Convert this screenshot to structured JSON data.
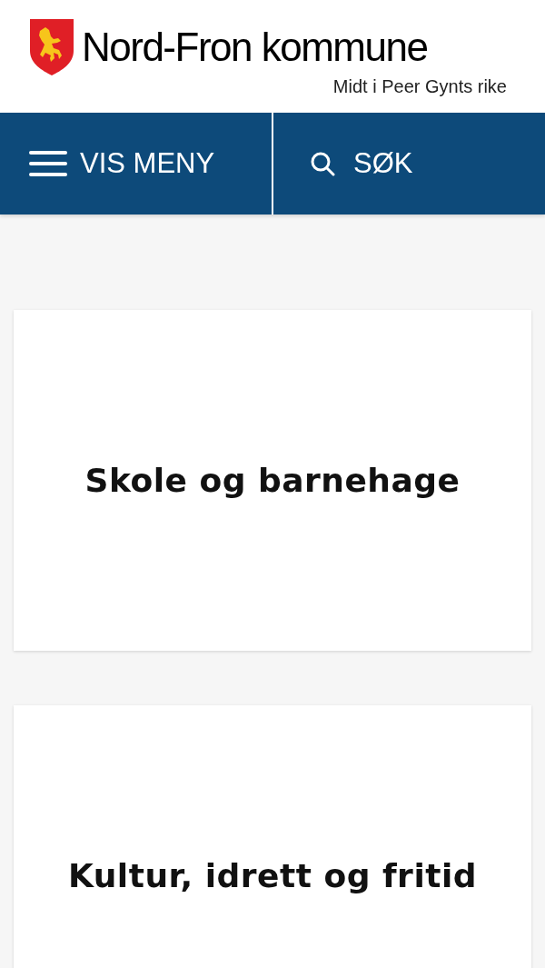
{
  "header": {
    "title": "Nord-Fron kommune",
    "tagline": "Midt i Peer Gynts rike"
  },
  "nav": {
    "menu_label": "VIS MENY",
    "search_label": "SØK"
  },
  "cards": [
    {
      "title": "Skole og barnehage"
    },
    {
      "title": "Kultur, idrett og fritid"
    }
  ]
}
